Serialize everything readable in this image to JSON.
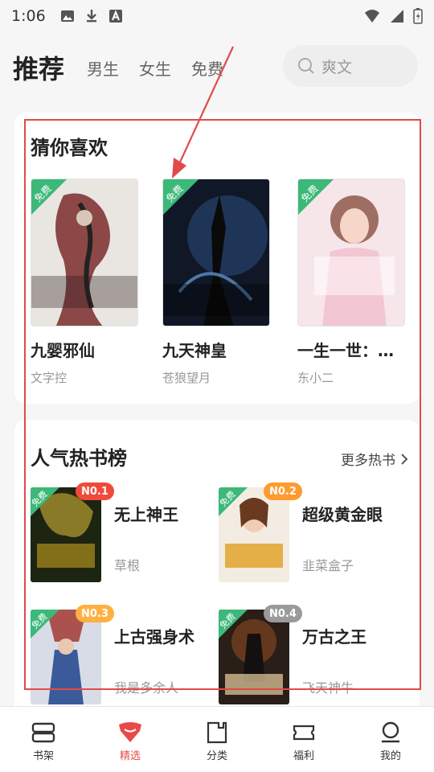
{
  "status": {
    "time": "1:06"
  },
  "nav": {
    "active": "推荐",
    "tabs": [
      "男生",
      "女生",
      "免费"
    ]
  },
  "search": {
    "placeholder": "爽文"
  },
  "recommend": {
    "title": "猜你喜欢",
    "free_label": "免费",
    "books": [
      {
        "title": "九婴邪仙",
        "author": "文字控"
      },
      {
        "title": "九天神皇",
        "author": "苍狼望月"
      },
      {
        "title": "一生一世：…",
        "author": "东小二"
      }
    ]
  },
  "hot": {
    "title": "人气热书榜",
    "more": "更多热书",
    "free_label": "免费",
    "items": [
      {
        "rank": "N0.1",
        "title": "无上神王",
        "author": "草根",
        "rank_color": "#f04a3a"
      },
      {
        "rank": "N0.2",
        "title": "超级黄金眼",
        "author": "韭菜盒子",
        "rank_color": "#ff9a2e"
      },
      {
        "rank": "N0.3",
        "title": "上古强身术",
        "author": "我是多余人",
        "rank_color": "#ffb040"
      },
      {
        "rank": "N0.4",
        "title": "万古之王",
        "author": "飞天神牛",
        "rank_color": "#9a9a9a"
      }
    ]
  },
  "tabbar": {
    "items": [
      {
        "label": "书架",
        "icon": "bookshelf-icon"
      },
      {
        "label": "精选",
        "icon": "featured-icon"
      },
      {
        "label": "分类",
        "icon": "category-icon"
      },
      {
        "label": "福利",
        "icon": "welfare-icon"
      },
      {
        "label": "我的",
        "icon": "profile-icon"
      }
    ]
  },
  "colors": {
    "accent": "#e84a4a",
    "free_badge": "#3cb878"
  }
}
